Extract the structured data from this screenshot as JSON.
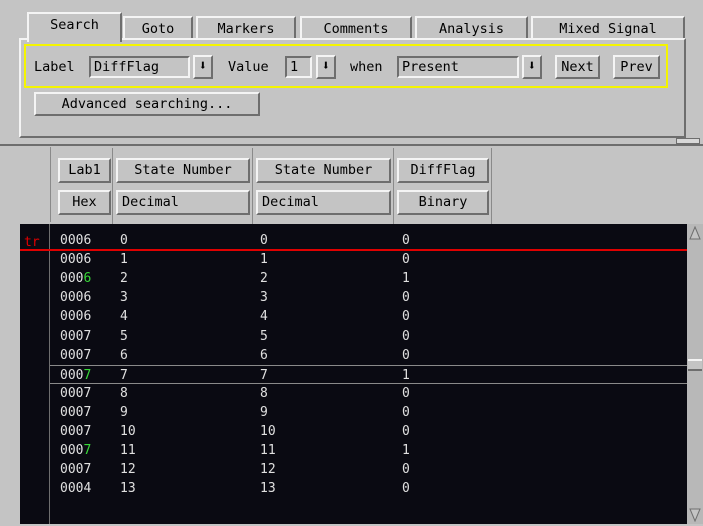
{
  "tabs": [
    {
      "label": "Search",
      "active": true
    },
    {
      "label": "Goto",
      "active": false
    },
    {
      "label": "Markers",
      "active": false
    },
    {
      "label": "Comments",
      "active": false
    },
    {
      "label": "Analysis",
      "active": false
    },
    {
      "label": "Mixed Signal",
      "active": false
    }
  ],
  "search": {
    "label_prefix": "Label",
    "label_value": "DiffFlag",
    "value_prefix": "Value",
    "value_value": "1",
    "when_prefix": "when",
    "when_value": "Present",
    "next_label": "Next",
    "prev_label": "Prev",
    "advanced_label": "Advanced searching..."
  },
  "columns": [
    {
      "name": "Lab1",
      "base": "Hex"
    },
    {
      "name": "State Number",
      "base": "Decimal"
    },
    {
      "name": "State Number",
      "base": "Decimal"
    },
    {
      "name": "DiffFlag",
      "base": "Binary"
    }
  ],
  "trigger_marker": "tr",
  "rows": [
    {
      "lab1": "0006",
      "lab1_green_digit": false,
      "s1": "0",
      "s2": "0",
      "diff": "0"
    },
    {
      "lab1": "0006",
      "lab1_green_digit": false,
      "s1": "1",
      "s2": "1",
      "diff": "0"
    },
    {
      "lab1": "0006",
      "lab1_green_digit": true,
      "s1": "2",
      "s2": "2",
      "diff": "1"
    },
    {
      "lab1": "0006",
      "lab1_green_digit": false,
      "s1": "3",
      "s2": "3",
      "diff": "0"
    },
    {
      "lab1": "0006",
      "lab1_green_digit": false,
      "s1": "4",
      "s2": "4",
      "diff": "0"
    },
    {
      "lab1": "0007",
      "lab1_green_digit": false,
      "s1": "5",
      "s2": "5",
      "diff": "0"
    },
    {
      "lab1": "0007",
      "lab1_green_digit": false,
      "s1": "6",
      "s2": "6",
      "diff": "0"
    },
    {
      "lab1": "0007",
      "lab1_green_digit": true,
      "s1": "7",
      "s2": "7",
      "diff": "1",
      "selected": true
    },
    {
      "lab1": "0007",
      "lab1_green_digit": false,
      "s1": "8",
      "s2": "8",
      "diff": "0"
    },
    {
      "lab1": "0007",
      "lab1_green_digit": false,
      "s1": "9",
      "s2": "9",
      "diff": "0"
    },
    {
      "lab1": "0007",
      "lab1_green_digit": false,
      "s1": "10",
      "s2": "10",
      "diff": "0"
    },
    {
      "lab1": "0007",
      "lab1_green_digit": true,
      "s1": "11",
      "s2": "11",
      "diff": "1"
    },
    {
      "lab1": "0007",
      "lab1_green_digit": false,
      "s1": "12",
      "s2": "12",
      "diff": "0"
    },
    {
      "lab1": "0004",
      "lab1_green_digit": false,
      "s1": "13",
      "s2": "13",
      "diff": "0"
    }
  ],
  "colors": {
    "trigger_line": "#e00000",
    "highlight": "#38d838",
    "data_bg": "#0a0a12",
    "panel_bg": "#c4c4c4",
    "search_outline": "#f4f400"
  },
  "icons": {
    "dropdown": "down-arrow-icon",
    "scroll_up": "scroll-up-arrow-icon",
    "scroll_down": "scroll-down-arrow-icon"
  }
}
